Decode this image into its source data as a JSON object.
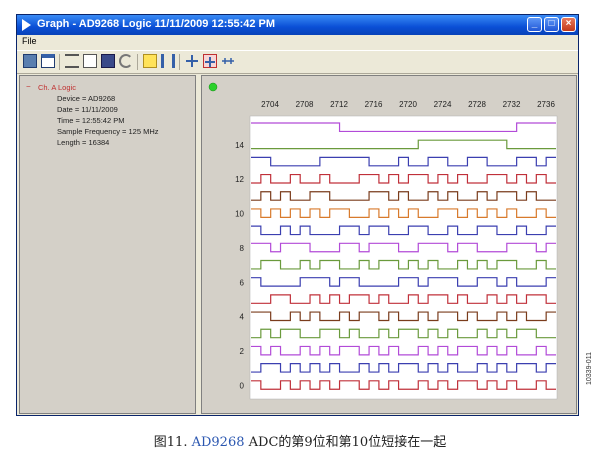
{
  "window": {
    "title": "Graph - AD9268 Logic 11/11/2009 12:55:42 PM",
    "buttons": {
      "minimize": "_",
      "maximize": "□",
      "close": "×"
    }
  },
  "menu": {
    "file": "File"
  },
  "toolbar": {
    "icons": [
      "window-icon",
      "window-alt-icon",
      "list-icon",
      "export-icon",
      "save-icon",
      "undo-icon",
      "highlight-icon",
      "columns-icon",
      "zoom-in-icon",
      "zoom-fit-icon",
      "zoom-out-icon"
    ]
  },
  "left_panel": {
    "channel_toggle": "−",
    "channel_label": "Ch. A Logic",
    "info": [
      "Device = AD9268",
      "Date = 11/11/2009",
      "Time = 12:55:42 PM",
      "Sample Frequency = 125 MHz",
      "Length = 16384"
    ]
  },
  "plot": {
    "status_color": "#2bd12b",
    "x_ticks": [
      "2704",
      "2708",
      "2712",
      "2716",
      "2720",
      "2724",
      "2728",
      "2732",
      "2736"
    ],
    "y_ticks": [
      "14",
      "12",
      "10",
      "8",
      "6",
      "4",
      "2",
      "0"
    ],
    "traces": [
      {
        "color": "#b24bd8",
        "pattern": "1111111110000000000000000001111"
      },
      {
        "color": "#6a9a3c",
        "pattern": "0000000000000000011111111100000"
      },
      {
        "color": "#3b3fb0",
        "pattern": "1100000111110001001100110001101"
      },
      {
        "color": "#c0303a",
        "pattern": "0100100100011010110101001101010"
      },
      {
        "color": "#7a3c1c",
        "pattern": "0101001100001101001010010110100"
      },
      {
        "color": "#d87a2c",
        "pattern": "1010101011001010100110101010010"
      },
      {
        "color": "#3b3fb0",
        "pattern": "1001010001101100110010011001001"
      },
      {
        "color": "#b24bd8",
        "pattern": "1101110001101110011101100011101"
      },
      {
        "color": "#6a9a3c",
        "pattern": "0110010110010110101001010110010"
      },
      {
        "color": "#3b3fb0",
        "pattern": "1000011101100001101110011010001"
      },
      {
        "color": "#c0303a",
        "pattern": "0011001010110100101101001010110"
      },
      {
        "color": "#7a3c1c",
        "pattern": "1100101001011010010110100101001"
      },
      {
        "color": "#6a9a3c",
        "pattern": "0101100110100101101010010101100"
      },
      {
        "color": "#b24bd8",
        "pattern": "1010010101101010010101101010010"
      },
      {
        "color": "#3b3fb0",
        "pattern": "0110101010010101101010010101101"
      },
      {
        "color": "#c0303a",
        "pattern": "1001010101101010010101101010010"
      }
    ]
  },
  "caption": {
    "prefix": "图11. ",
    "id": "AD9268",
    "suffix": " ADC的第9位和第10位短接在一起"
  },
  "side_code": "10339-011"
}
